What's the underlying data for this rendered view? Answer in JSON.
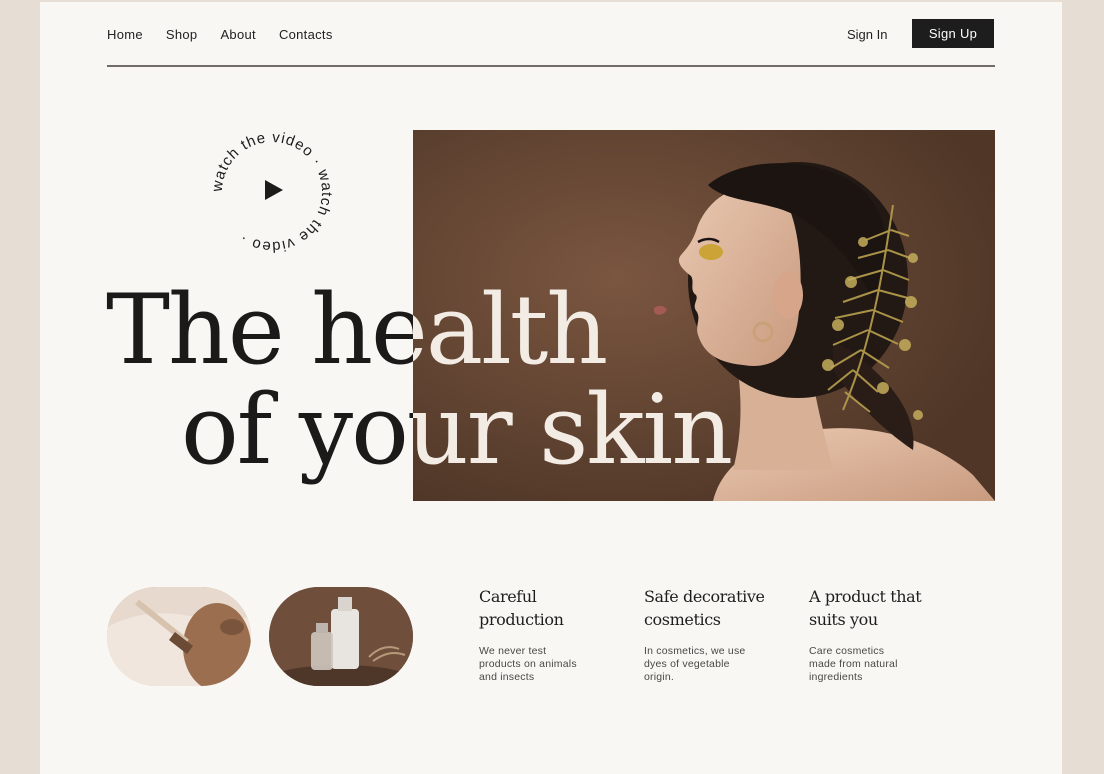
{
  "nav": {
    "links": [
      "Home",
      "Shop",
      "About",
      "Contacts"
    ],
    "sign_in": "Sign In",
    "sign_up": "Sign Up"
  },
  "video": {
    "circular_text": "watch the video · watch the video · ",
    "icon": "play-icon"
  },
  "hero": {
    "line1": "The health",
    "line2": "of your skin"
  },
  "features": [
    {
      "title_l1": "Careful",
      "title_l2": "production",
      "text_l1": "We never test",
      "text_l2": "products on animals",
      "text_l3": "and insects"
    },
    {
      "title_l1": "Safe decorative",
      "title_l2": "cosmetics",
      "text_l1": "In cosmetics, we use",
      "text_l2": "dyes of vegetable",
      "text_l3": "origin."
    },
    {
      "title_l1": "A product that",
      "title_l2": "suits you",
      "text_l1": "Care cosmetics",
      "text_l2": "made from natural",
      "text_l3": "ingredients"
    }
  ],
  "colors": {
    "page_bg": "#f9f7f4",
    "outer_bg": "#e6ddd5",
    "photo_bg": "#5d402f",
    "text": "#1b1a19"
  }
}
